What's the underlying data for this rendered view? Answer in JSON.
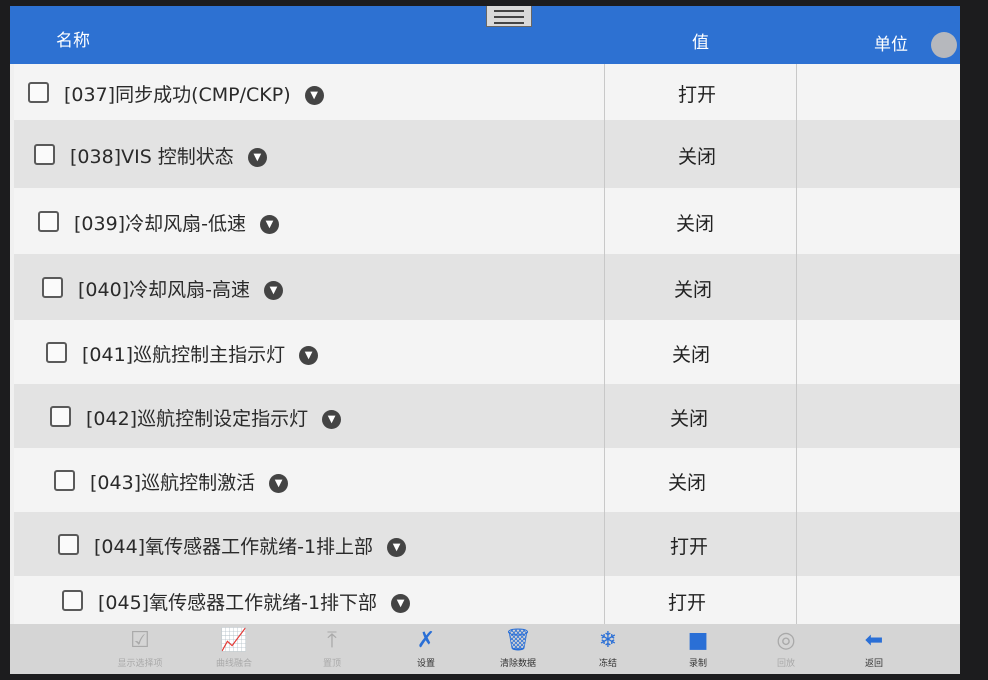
{
  "header": {
    "name_label": "名称",
    "value_label": "值",
    "unit_label": "单位"
  },
  "rows": [
    {
      "name": "[037]同步成功(CMP/CKP)",
      "value": "打开"
    },
    {
      "name": "[038]VIS 控制状态",
      "value": "关闭"
    },
    {
      "name": "[039]冷却风扇-低速",
      "value": "关闭"
    },
    {
      "name": "[040]冷却风扇-高速",
      "value": "关闭"
    },
    {
      "name": "[041]巡航控制主指示灯",
      "value": "关闭"
    },
    {
      "name": "[042]巡航控制设定指示灯",
      "value": "关闭"
    },
    {
      "name": "[043]巡航控制激活",
      "value": "关闭"
    },
    {
      "name": "[044]氧传感器工作就绪-1排上部",
      "value": "打开"
    },
    {
      "name": "[045]氧传感器工作就绪-1排下部",
      "value": "打开"
    }
  ],
  "toolbar": [
    {
      "label": "显示选择项",
      "icon": "checkbox-icon",
      "glyph": "☑",
      "state": "disabled"
    },
    {
      "label": "曲线融合",
      "icon": "chart-icon",
      "glyph": "📈",
      "state": "disabled"
    },
    {
      "label": "置顶",
      "icon": "pin-top-icon",
      "glyph": "⤒",
      "state": "disabled"
    },
    {
      "label": "设置",
      "icon": "wrench-icon",
      "glyph": "✗",
      "state": "enabled"
    },
    {
      "label": "清除数据",
      "icon": "trash-icon",
      "glyph": "🗑",
      "state": "enabled"
    },
    {
      "label": "冻结",
      "icon": "snowflake-icon",
      "glyph": "❄",
      "state": "enabled"
    },
    {
      "label": "录制",
      "icon": "video-camera-icon",
      "glyph": "■",
      "state": "enabled"
    },
    {
      "label": "回放",
      "icon": "playback-icon",
      "glyph": "◎",
      "state": "disabled"
    },
    {
      "label": "返回",
      "icon": "back-arrow-icon",
      "glyph": "⬅",
      "state": "enabled"
    }
  ],
  "colors": {
    "header": "#2d71d2",
    "accent": "#2a6fd6"
  }
}
